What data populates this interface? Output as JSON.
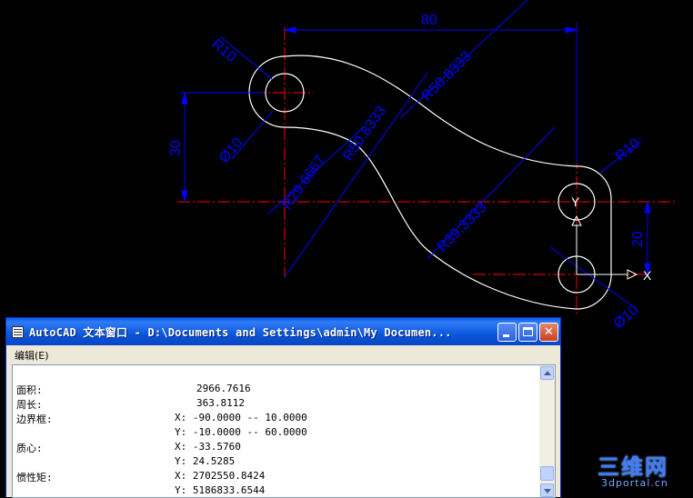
{
  "drawing": {
    "dimensions": {
      "width_80": "80",
      "height_30": "30",
      "height_20": "20",
      "r10_top_left": "R10",
      "r10_right": "R10",
      "r50_a": "R50.8333",
      "r50_b": "R50.8333",
      "r29": "R29.6667",
      "r39": "R39.3333",
      "d10_left": "Ø10",
      "d10_right": "Ø10"
    },
    "ucs": {
      "x_label": "X",
      "y_label": "Y"
    },
    "colors": {
      "geometry": "#FFFFFF",
      "dimension": "#0000FF",
      "centerline": "#FF0000"
    }
  },
  "window": {
    "title": "AutoCAD 文本窗口 - D:\\Documents and Settings\\admin\\My Documen...",
    "menu_edit": "编辑(E)",
    "lines": [
      {
        "label": "面积:",
        "value": "2966.7616"
      },
      {
        "label": "周长:",
        "value": "363.8112"
      },
      {
        "label": "边界框:",
        "value": "X: -90.0000  --  10.0000"
      },
      {
        "label": "",
        "value": "Y: -10.0000  --  60.0000"
      },
      {
        "label": "质心:",
        "value": "X: -33.5760"
      },
      {
        "label": "",
        "value": "Y: 24.5285"
      },
      {
        "label": "惯性矩:",
        "value": "X: 2702550.8424"
      },
      {
        "label": "",
        "value": "Y: 5186833.6544"
      }
    ]
  },
  "watermark": {
    "main": "三维网",
    "sub": "3dportal.cn"
  }
}
